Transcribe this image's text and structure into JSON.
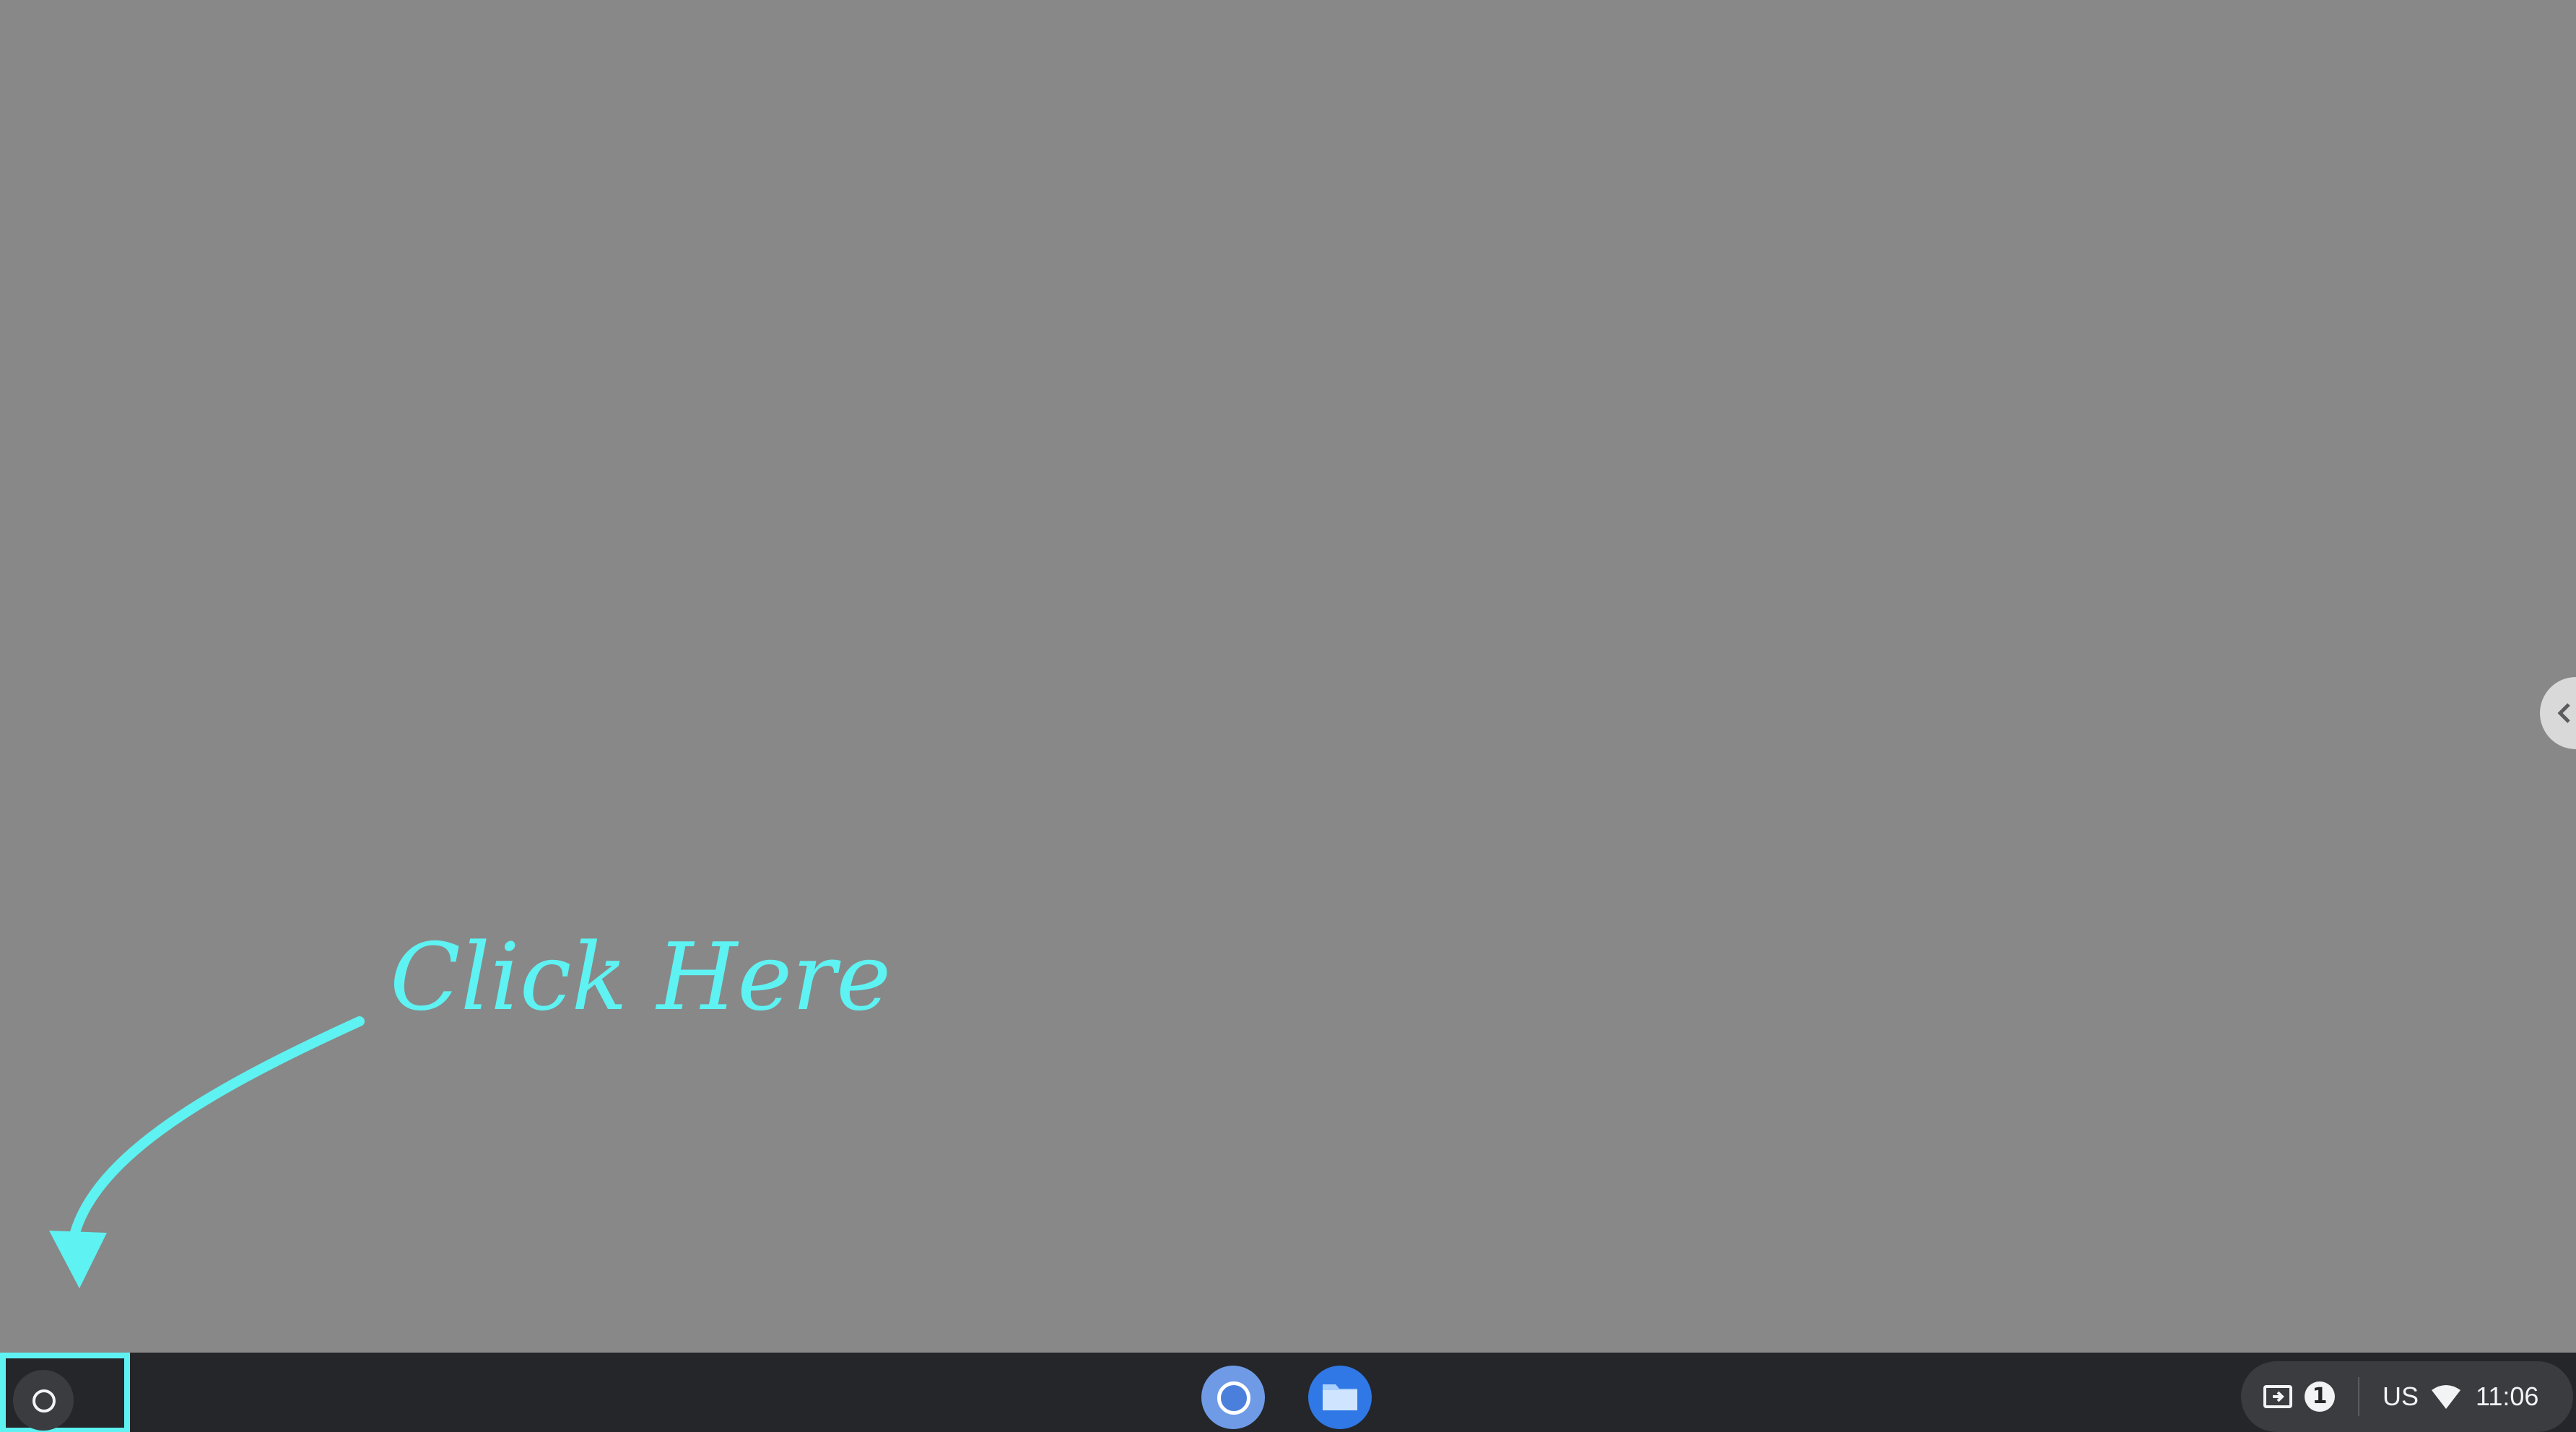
{
  "annotation": {
    "text": "Click Here",
    "color": "#5ef2f2"
  },
  "shelf": {
    "launcher": {
      "icon": "launcher-circle-icon"
    },
    "pinned_apps": [
      {
        "name": "chrome",
        "icon": "chrome-icon"
      },
      {
        "name": "files",
        "icon": "folder-icon"
      }
    ]
  },
  "status_tray": {
    "screen_capture_icon": "screen-share-icon",
    "notification_count": "1",
    "keyboard_layout": "US",
    "wifi_icon": "wifi-icon",
    "time": "11:06"
  },
  "colors": {
    "desktop_background": "#888888",
    "shelf_background": "#24262a",
    "highlight": "#5ef2f2"
  }
}
